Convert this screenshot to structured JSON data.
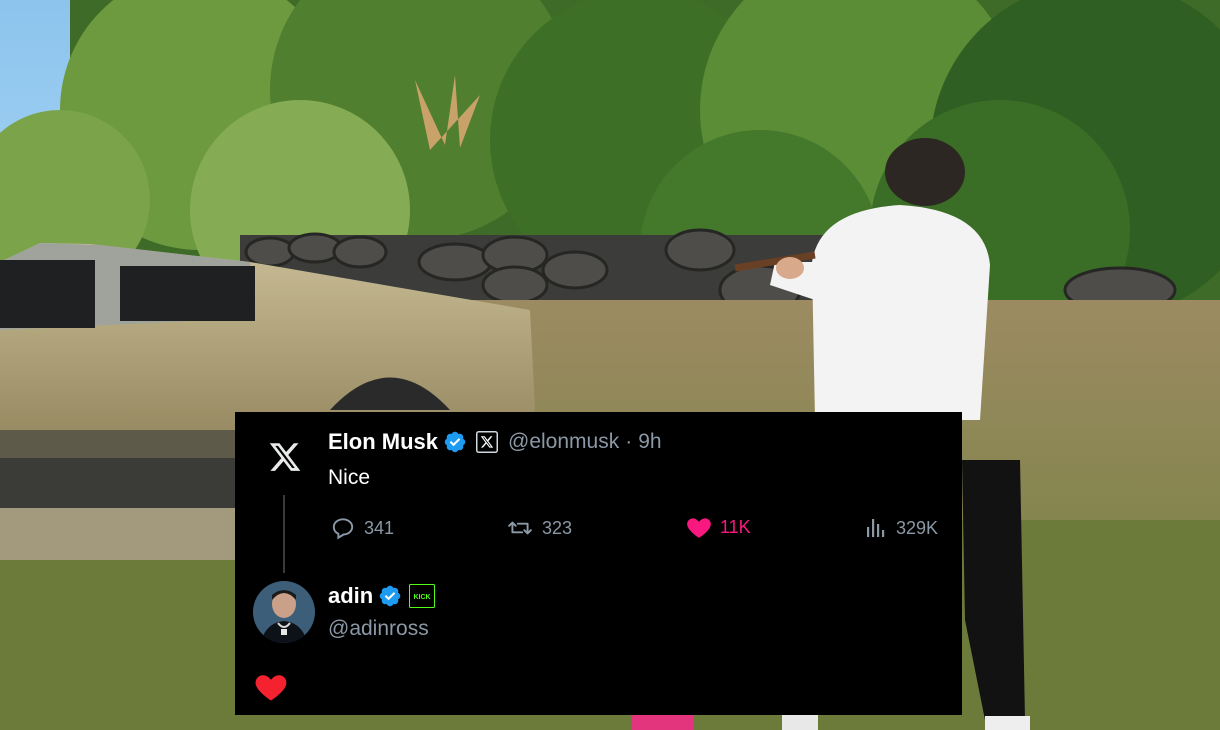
{
  "tweet": {
    "author_name": "Elon Musk",
    "author_handle": "@elonmusk",
    "separator": "·",
    "time": "9h",
    "text": "Nice",
    "metrics": {
      "replies": "341",
      "reposts": "323",
      "likes": "11K",
      "views": "329K"
    },
    "liked": true
  },
  "reply": {
    "author_name": "adin",
    "author_handle": "@adinross",
    "badge_text": "KICK"
  },
  "icons": {
    "platform": "x-logo-icon",
    "verified": "verified-badge-icon",
    "affiliation": "x-affiliation-icon",
    "reply": "reply-icon",
    "repost": "repost-icon",
    "like": "heart-icon",
    "views": "views-icon",
    "reply_reaction": "heart-icon"
  },
  "colors": {
    "card_background": "#000000",
    "verified": "#1d9bf0",
    "like_active": "#f91880",
    "reaction_heart": "#f4212e",
    "muted_text": "#8b98a5",
    "kick_green": "#53fc18"
  }
}
